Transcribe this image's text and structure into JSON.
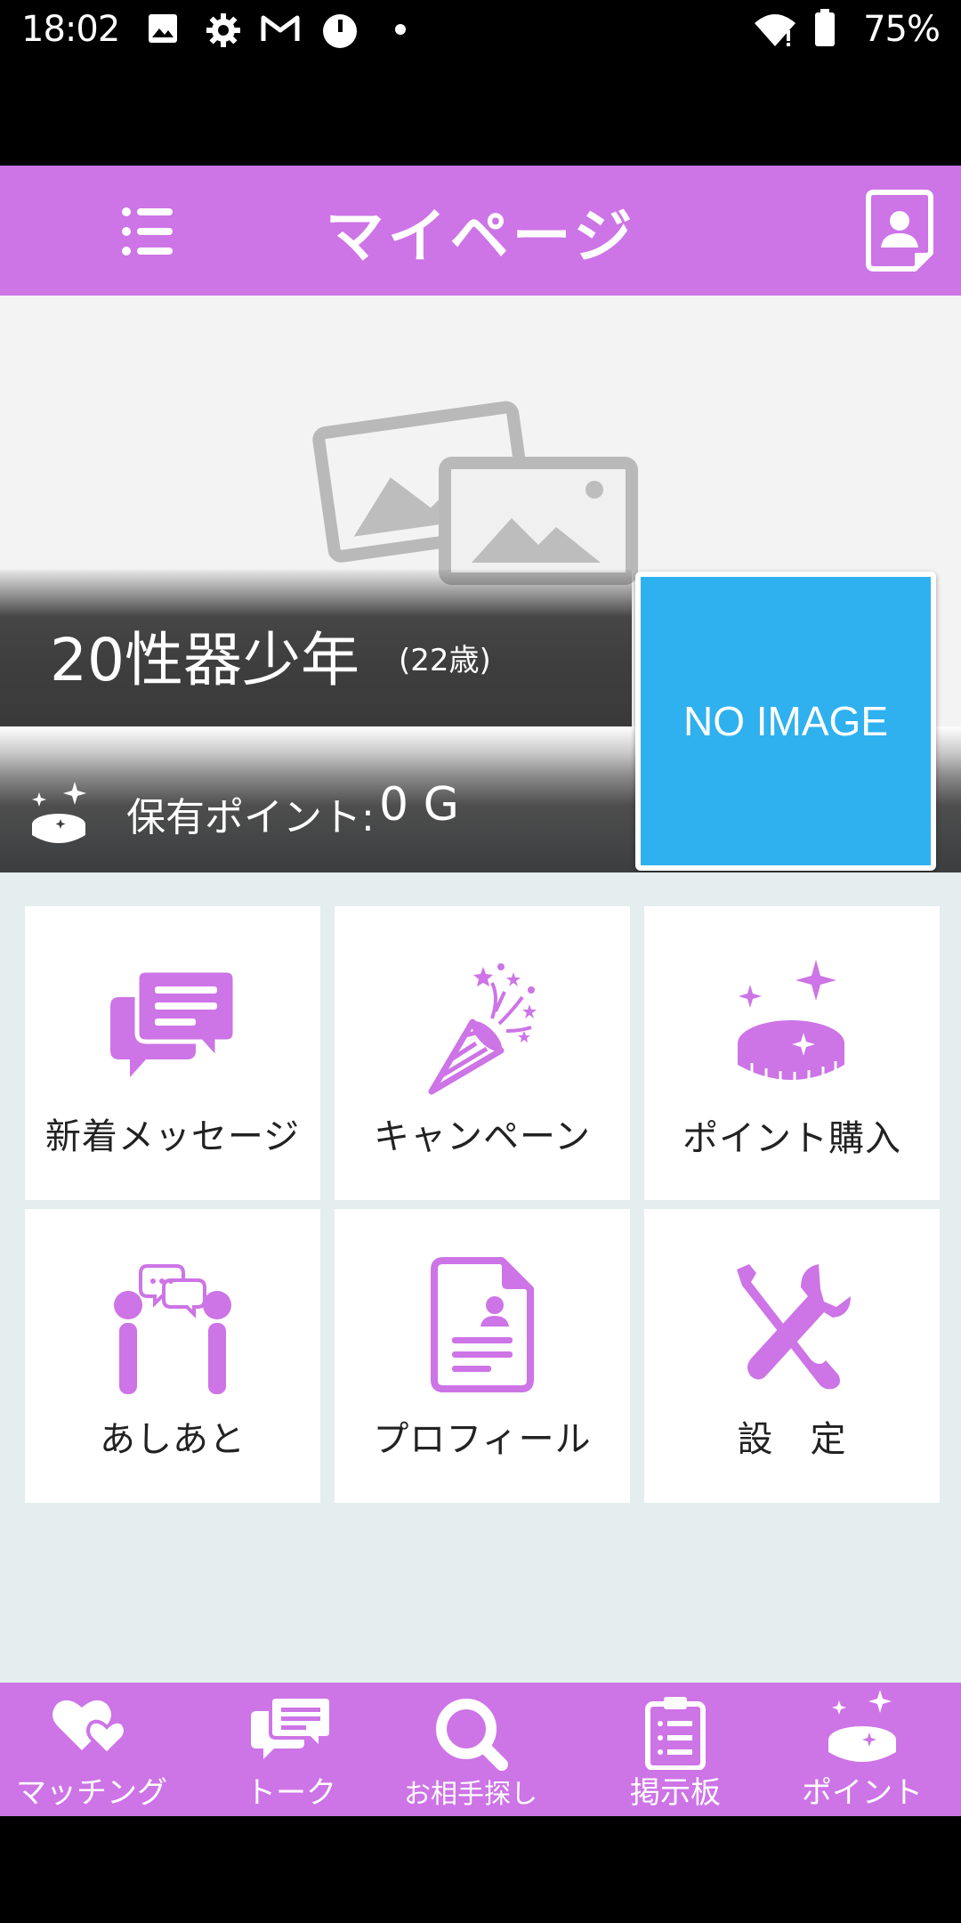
{
  "status_bar": {
    "time": "18:02",
    "battery": "75%"
  },
  "header": {
    "title": "マイページ"
  },
  "profile": {
    "name": "20性器少年",
    "age": "(22歳)",
    "points_label": "保有ポイント:",
    "points_value": "0 G",
    "avatar_text": "NO IMAGE"
  },
  "menu": {
    "new_messages": "新着メッセージ",
    "campaign": "キャンペーン",
    "buy_points": "ポイント購入",
    "footprints": "あしあと",
    "profile": "プロフィール",
    "settings": "設　定"
  },
  "bottom_nav": {
    "matching": "マッチング",
    "talk": "トーク",
    "search": "お相手探し",
    "board": "掲示板",
    "points": "ポイント"
  },
  "colors": {
    "accent": "#cd74e6",
    "avatar": "#2fb1f0",
    "background": "#e4eeef"
  }
}
